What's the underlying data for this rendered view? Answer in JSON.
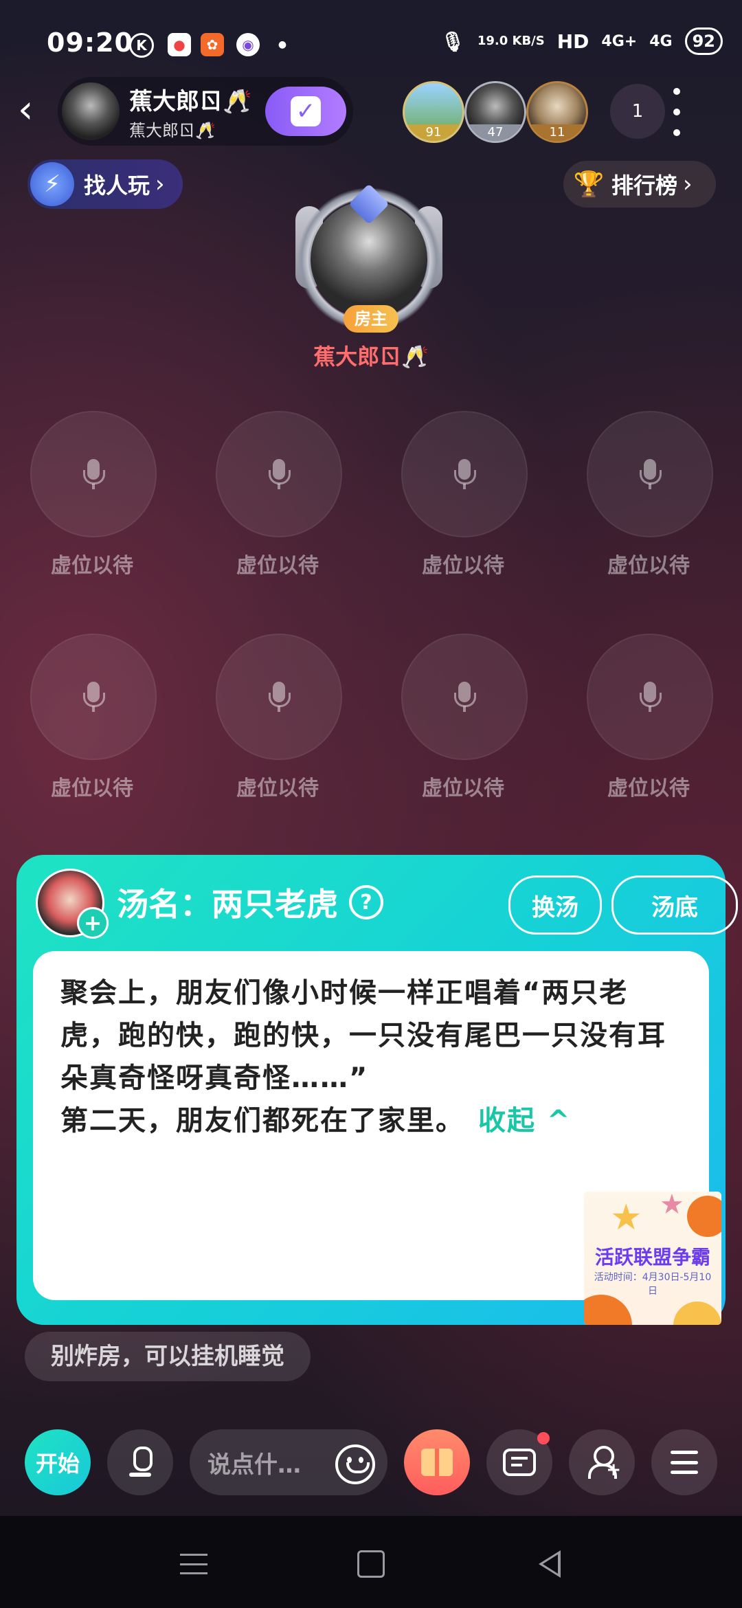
{
  "status_bar": {
    "time": "09:20",
    "icons": [
      "k-app-icon",
      "map-app-icon",
      "orange-app-icon",
      "planet-app-icon"
    ],
    "speed": "19.0 KB/S",
    "hd": "HD",
    "net1": "4G+",
    "net2": "4G",
    "battery": "92"
  },
  "header": {
    "back_label": "‹",
    "owner_name": "蕉大郎ㄖ🥂",
    "owner_sub": "蕉大郎ㄖ🥂",
    "viewers": [
      {
        "badge": "91",
        "color": "#d4b34a"
      },
      {
        "badge": "47",
        "color": "#9aa0ad"
      },
      {
        "badge": "11",
        "color": "#b9833d"
      }
    ],
    "viewer_count": "1"
  },
  "actions": {
    "find_label": "找人玩",
    "rank_label": "排行榜"
  },
  "host": {
    "badge": "房主",
    "name": "蕉大郎ㄖ🥂"
  },
  "seats": [
    "虚位以待",
    "虚位以待",
    "虚位以待",
    "虚位以待",
    "虚位以待",
    "虚位以待",
    "虚位以待",
    "虚位以待"
  ],
  "puzzle": {
    "title": "汤名：两只老虎",
    "change_label": "换汤",
    "answer_label": "汤底",
    "story_line1": "聚会上，朋友们像小时候一样正唱着“两只老虎，跑的快，跑的快，一只没有尾巴一只没有耳朵真奇怪呀真奇怪……”",
    "story_line2": "第二天，朋友们都死在了家里。",
    "collapse_label": "收起 ^",
    "promo_title": "活跃联盟争霸",
    "promo_sub": "活动时间：4月30日-5月10日"
  },
  "notice": "别炸房，可以挂机睡觉",
  "bottom_bar": {
    "start_label": "开始",
    "say_placeholder": "说点什…"
  }
}
